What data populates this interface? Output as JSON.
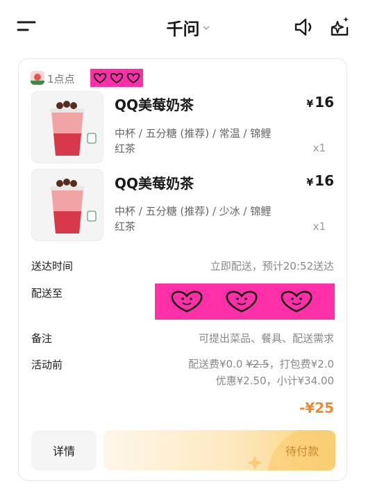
{
  "header": {
    "title": "千问"
  },
  "card": {
    "shop": {
      "name": "1点点"
    },
    "items": [
      {
        "name": "QQ美莓奶茶",
        "currency": "¥",
        "price": "16",
        "spec": "中杯 / 五分糖 (推荐) / 常温 / 锦鲤红茶",
        "qty": "x1"
      },
      {
        "name": "QQ美莓奶茶",
        "currency": "¥",
        "price": "16",
        "spec": "中杯 / 五分糖 (推荐) / 少冰 / 锦鲤红茶",
        "qty": "x1"
      }
    ],
    "delivery_time": {
      "label": "送达时间",
      "value": "立即配送，预计20:52送达"
    },
    "deliver_to": {
      "label": "配送至"
    },
    "remark": {
      "label": "备注",
      "placeholder": "可提出菜品、餐具、配送需求"
    },
    "pricing": {
      "label": "活动前",
      "delivery_fee_label": "配送费",
      "delivery_fee": "¥0.0",
      "delivery_fee_original": "¥2.5",
      "packing_fee_text": "，打包费¥2.0",
      "discount_text": "优惠¥2.50，小计¥34.00"
    },
    "total": "-¥25",
    "buttons": {
      "detail": "详情",
      "pay": "待付款"
    }
  },
  "colors": {
    "accent_orange": "#e98b34",
    "redaction_pink": "#ff2fa8"
  }
}
